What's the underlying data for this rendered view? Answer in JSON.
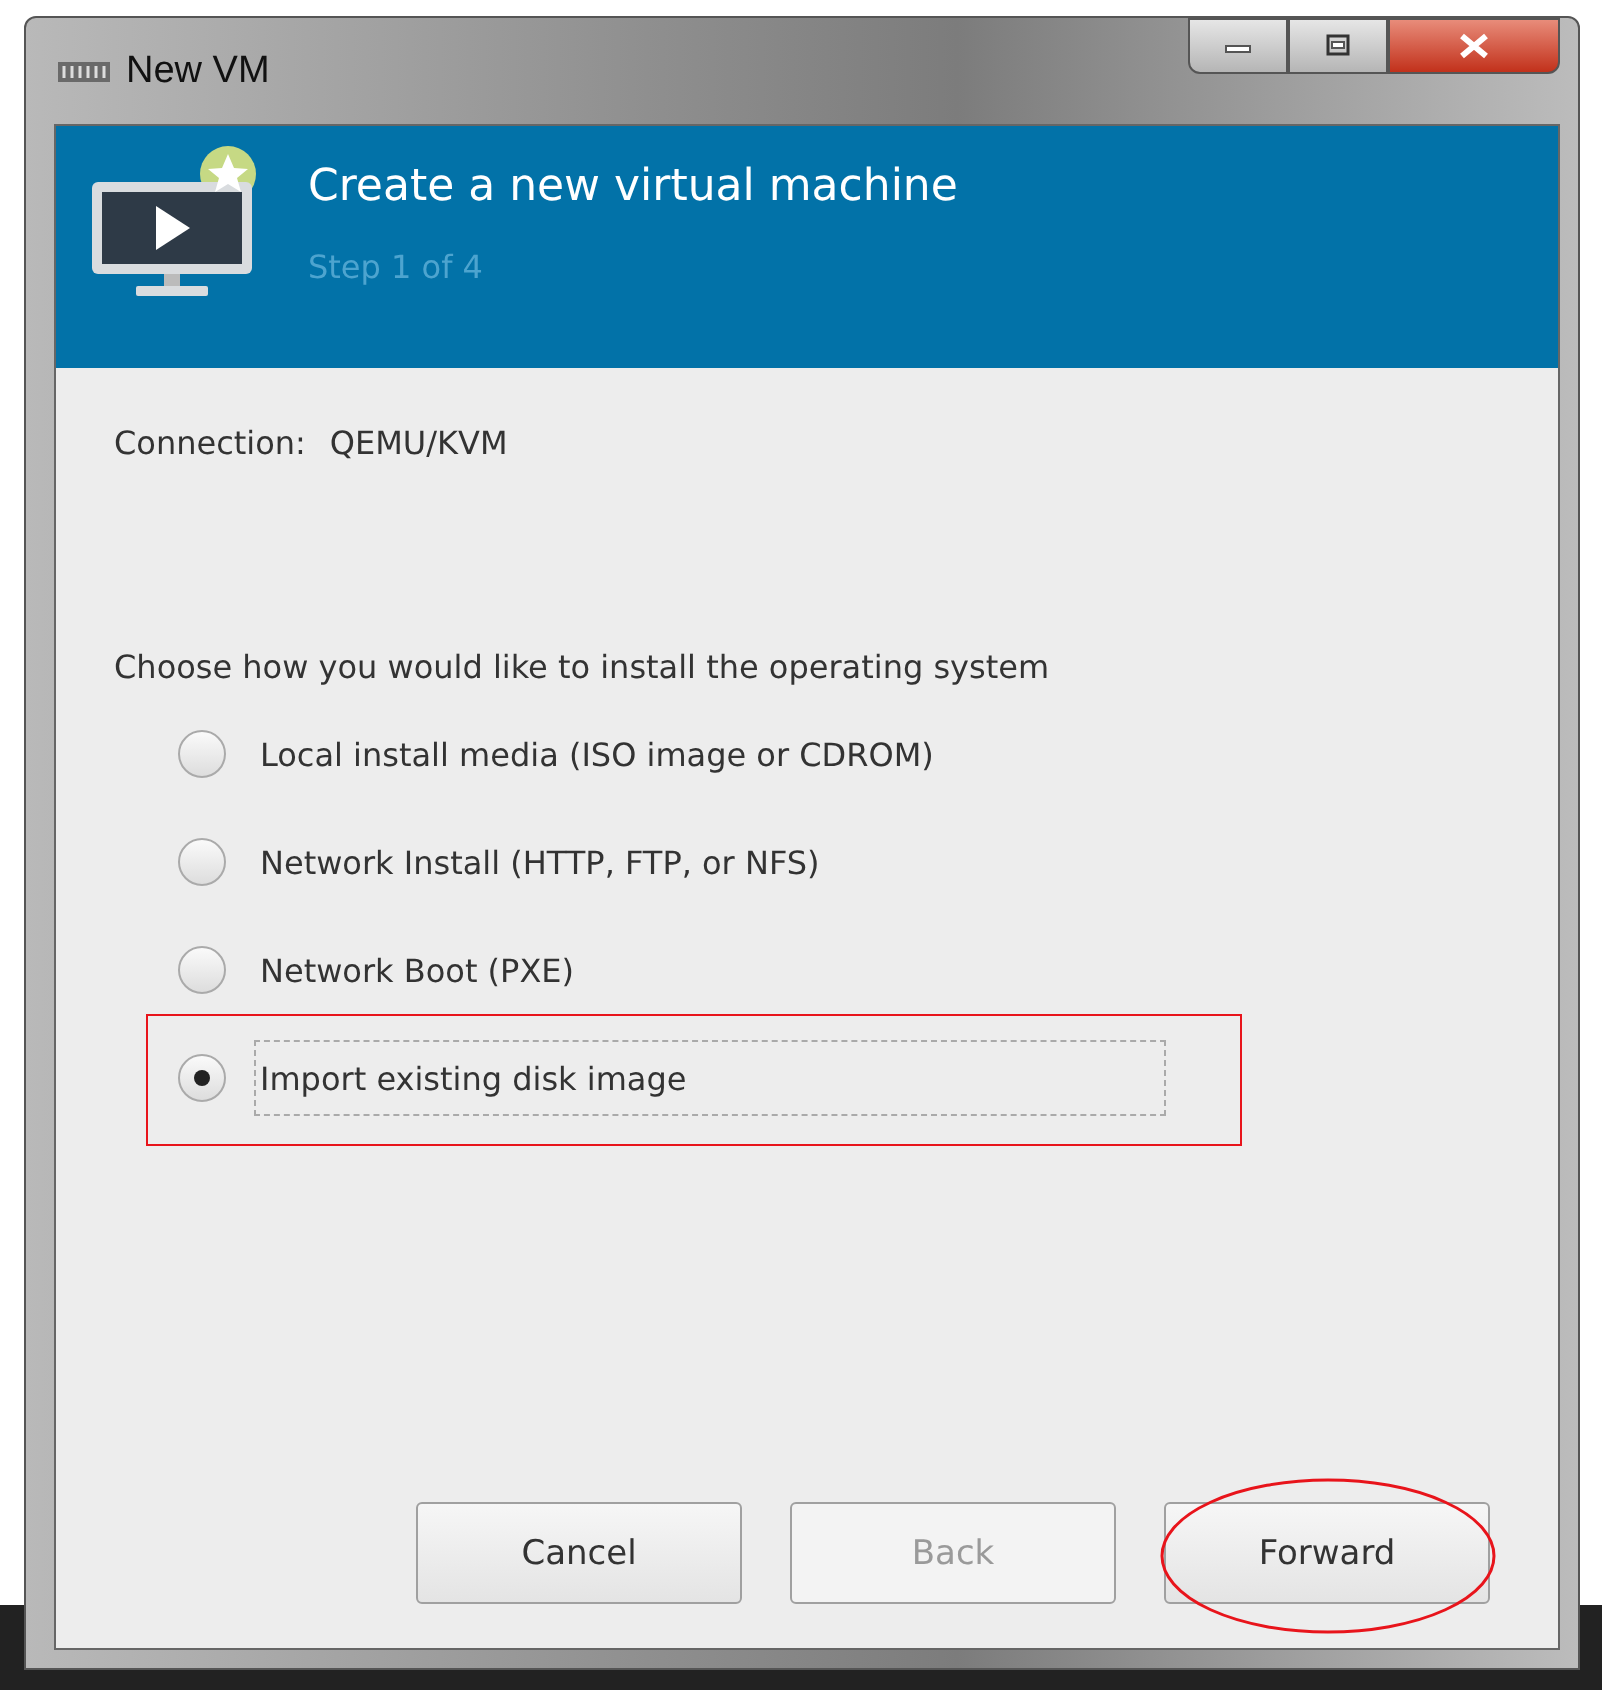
{
  "window": {
    "title": "New VM"
  },
  "header": {
    "title": "Create a new virtual machine",
    "step": "Step 1 of 4"
  },
  "connection": {
    "label": "Connection:",
    "value": "QEMU/KVM"
  },
  "prompt": "Choose how you would like to install the operating system",
  "options": [
    {
      "label": "Local install media (ISO image or CDROM)",
      "selected": false,
      "focused": false,
      "highlighted": false
    },
    {
      "label": "Network Install (HTTP, FTP, or NFS)",
      "selected": false,
      "focused": false,
      "highlighted": false
    },
    {
      "label": "Network Boot (PXE)",
      "selected": false,
      "focused": false,
      "highlighted": false
    },
    {
      "label": "Import existing disk image",
      "selected": true,
      "focused": true,
      "highlighted": true
    }
  ],
  "buttons": [
    {
      "label": "Cancel",
      "disabled": false,
      "highlighted": false
    },
    {
      "label": "Back",
      "disabled": true,
      "highlighted": false
    },
    {
      "label": "Forward",
      "disabled": false,
      "highlighted": true
    }
  ]
}
